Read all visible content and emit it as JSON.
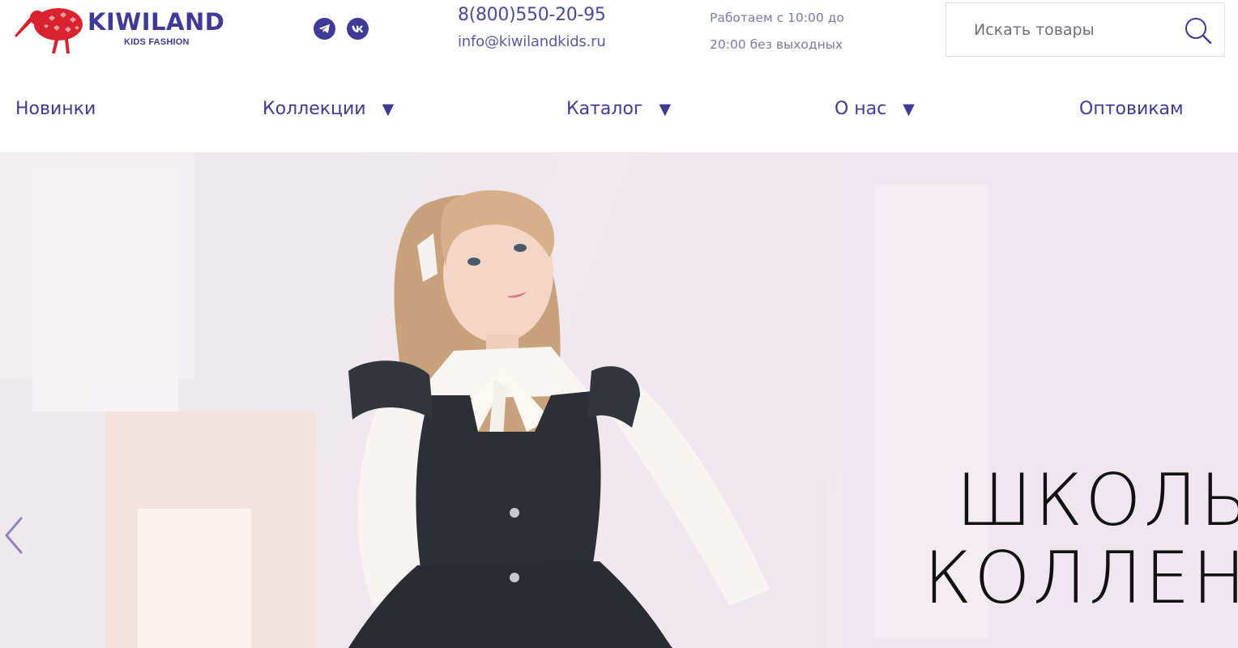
{
  "header": {
    "logo": {
      "name": "KIWILAND",
      "tagline": "KIDS FASHION"
    },
    "social": [
      {
        "icon": "telegram-icon"
      },
      {
        "icon": "vk-icon"
      }
    ],
    "phone": "8(800)550-20-95",
    "email": "info@kiwilandkids.ru",
    "hours": [
      "Работаем с 10:00 до",
      "20:00 без выходных"
    ],
    "search": {
      "placeholder": "Искать товары",
      "icon": "search-icon"
    }
  },
  "nav": {
    "items": [
      {
        "label": "Новинки",
        "has_dropdown": false
      },
      {
        "label": "Коллекции",
        "has_dropdown": true
      },
      {
        "label": "Каталог",
        "has_dropdown": true
      },
      {
        "label": "О нас",
        "has_dropdown": true
      },
      {
        "label": "Оптовикам",
        "has_dropdown": false
      }
    ],
    "dropdown_glyph": "▼"
  },
  "hero": {
    "title_line1": "ШКОЛЬ",
    "title_line2": "КОЛЛЕН",
    "prev_icon": "chevron-left-icon"
  },
  "colors": {
    "brand": "#3f3a96",
    "logo_red": "#d9232e",
    "hero_bg": "#efe9ee",
    "title": "#111111"
  }
}
